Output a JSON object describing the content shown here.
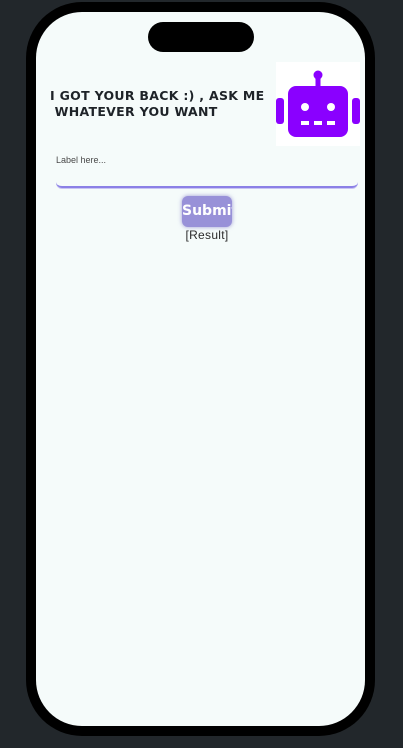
{
  "header": {
    "title": "I GOT YOUR BACK :) , ASK ME\n WHATEVER YOU WANT"
  },
  "logo": {
    "icon": "robot-icon",
    "color": "#8a00ff"
  },
  "form": {
    "label_placeholder": "Label here...",
    "submit_label": "Submit",
    "result_text": "[Result]"
  }
}
